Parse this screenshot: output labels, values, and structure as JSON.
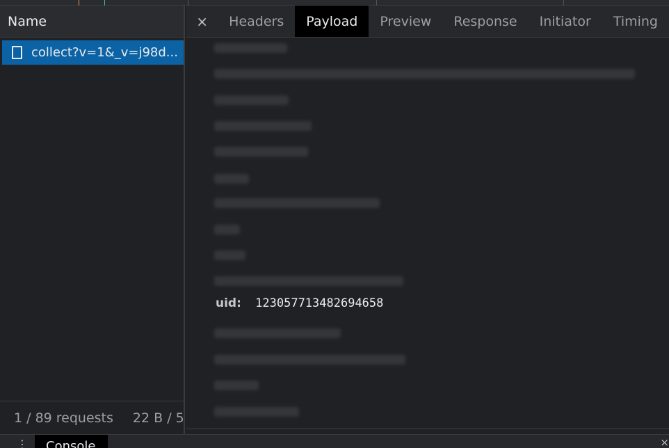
{
  "request_list": {
    "header": "Name",
    "selected_request": "collect?v=1&_v=j98d...",
    "footer": {
      "requests": "1 / 89 requests",
      "transferred": "22 B / 5."
    }
  },
  "details": {
    "close_symbol": "×",
    "tabs": [
      "Headers",
      "Payload",
      "Preview",
      "Response",
      "Initiator",
      "Timing"
    ],
    "active_tab": "Payload"
  },
  "payload": {
    "visible_key": "uid:",
    "visible_value": "123057713482694658"
  },
  "drawer": {
    "menu_symbol": "⋮",
    "tab": "Console",
    "close_symbol": "×"
  },
  "colors": {
    "selected_row": "#0b63a5",
    "active_tab": "#000000",
    "background": "#202124"
  }
}
